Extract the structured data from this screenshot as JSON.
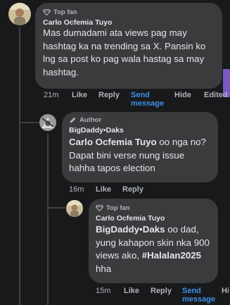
{
  "comment1": {
    "badge": "Top fan",
    "author": "Carlo Ocfemia Tuyo",
    "text": "Mas dumadami ata views pag may hashtag ka na trending sa X. Pansin ko lng sa post ko pag wala hastag sa may hashtag.",
    "time": "21m",
    "like": "Like",
    "reply": "Reply",
    "send_message": "Send message",
    "hide": "Hide",
    "edited": "Edited"
  },
  "comment2": {
    "badge": "Author",
    "author": "BigDaddy•Daks",
    "mention": "Carlo Ocfemia Tuyo",
    "text": " oo nga no? Dapat bini verse nung issue hahha tapos election",
    "time": "16m",
    "like": "Like",
    "reply": "Reply"
  },
  "comment3": {
    "badge": "Top fan",
    "author": "Carlo Ocfemia Tuyo",
    "mention": "BigDaddy•Daks",
    "text": " oo dad, yung kahapon skin nka 900 views ako,",
    "hashtag": "#Halalan2025",
    "text_end": " hha",
    "time": "15m",
    "like": "Like",
    "reply": "Reply",
    "send_message": "Send message",
    "hide": "Hi"
  },
  "colors": {
    "background": "#18191a",
    "bubble": "#3a3b3c",
    "link": "#3b8fe8",
    "muted": "#b0b3b8",
    "accent": "#7a58c0"
  }
}
